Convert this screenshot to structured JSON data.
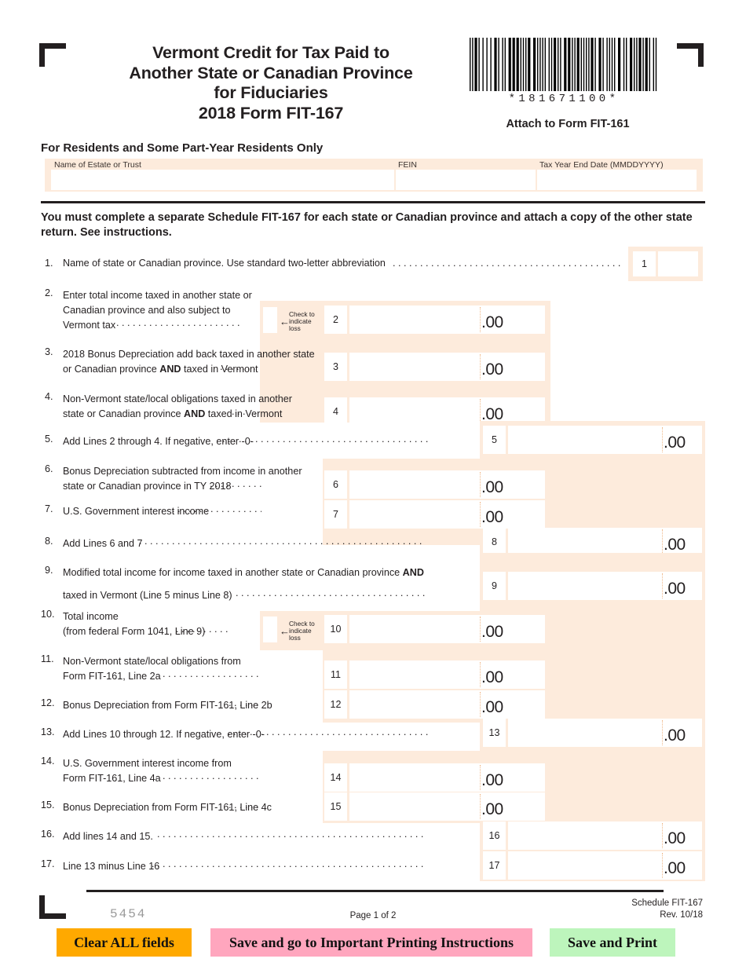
{
  "form": {
    "title_lines": [
      "Vermont Credit for Tax Paid to",
      "Another State or Canadian Province",
      "for Fiduciaries",
      "2018 Form FIT-167"
    ],
    "barcode_text": "*181671100*",
    "attach_note": "Attach to Form FIT-161",
    "residents_note": "For Residents and Some Part-Year Residents Only",
    "instruction": "You must complete a separate Schedule FIT-167 for each state or Canadian province and attach a copy of the other state return.  See instructions."
  },
  "entity": {
    "name_label": "Name of Estate or Trust",
    "name_value": "",
    "fein_label": "FEIN",
    "fein_value": "",
    "tax_year_label": "Tax Year End Date (MMDDYYYY)",
    "tax_year_value": ""
  },
  "loss_check": {
    "arrow": "←",
    "line1": "Check to",
    "line2": "indicate",
    "line3": "loss"
  },
  "cents": ".00",
  "lines": [
    {
      "num": "1",
      "label": "Name of state or Canadian province.  Use standard two-letter abbreviation",
      "value": "",
      "box": "1"
    },
    {
      "num": "2",
      "label_a": "Enter total income taxed in another state or",
      "label_b": "Canadian province and also subject to",
      "label_c": "Vermont tax",
      "value": "",
      "box": "2"
    },
    {
      "num": "3",
      "label_a": "2018 Bonus Depreciation add back taxed in another state",
      "label_b": "or Canadian province AND taxed in Vermont",
      "value": "",
      "box": "3"
    },
    {
      "num": "4",
      "label_a": "Non-Vermont state/local obligations taxed in another",
      "label_b": "state or Canadian province AND taxed in Vermont",
      "value": "",
      "box": "4"
    },
    {
      "num": "5",
      "label": "Add Lines 2 through 4.  If negative, enter -0-",
      "value": "",
      "box": "5"
    },
    {
      "num": "6",
      "label_a": "Bonus Depreciation subtracted from income in another",
      "label_b": "state or Canadian province in TY 2018",
      "value": "",
      "box": "6"
    },
    {
      "num": "7",
      "label": "U.S. Government interest income",
      "value": "",
      "box": "7"
    },
    {
      "num": "8",
      "label": "Add Lines 6 and 7",
      "value": "",
      "box": "8"
    },
    {
      "num": "9",
      "label_a": "Modified total income for income taxed in another state or Canadian province AND",
      "label_b": "taxed in Vermont (Line 5 minus Line 8)",
      "value": "",
      "box": "9"
    },
    {
      "num": "10",
      "label_a": "Total income",
      "label_b": "(from federal Form 1041, Line 9)",
      "value": "",
      "box": "10"
    },
    {
      "num": "11",
      "label_a": "Non-Vermont state/local obligations from",
      "label_b": "Form FIT-161, Line 2a",
      "value": "",
      "box": "11"
    },
    {
      "num": "12",
      "label": "Bonus Depreciation from Form FIT-161, Line 2b",
      "value": "",
      "box": "12"
    },
    {
      "num": "13",
      "label": "Add Lines 10 through 12.  If negative, enter -0-",
      "value": "",
      "box": "13"
    },
    {
      "num": "14",
      "label_a": "U.S. Government interest income from",
      "label_b": "Form FIT-161, Line 4a",
      "value": "",
      "box": "14"
    },
    {
      "num": "15",
      "label": "Bonus Depreciation from Form FIT-161, Line 4c",
      "value": "",
      "box": "15"
    },
    {
      "num": "16",
      "label": "Add lines 14 and 15.",
      "value": "",
      "box": "16"
    },
    {
      "num": "17",
      "label": "Line 13 minus Line 16",
      "value": "",
      "box": "17"
    }
  ],
  "footer": {
    "form_code": "5454",
    "page": "Page 1 of 2",
    "schedule": "Schedule FIT-167",
    "revision": "Rev. 10/18"
  },
  "buttons": {
    "clear": "Clear ALL fields",
    "save_print_instructions": "Save and go to Important Printing Instructions",
    "save_print": "Save and Print"
  },
  "colors": {
    "field_shade": "#fdebdc",
    "clear_button": "#ffa900",
    "instructions_button": "#ffa6be",
    "save_button": "#bdf5bc",
    "ink": "#231f20"
  }
}
